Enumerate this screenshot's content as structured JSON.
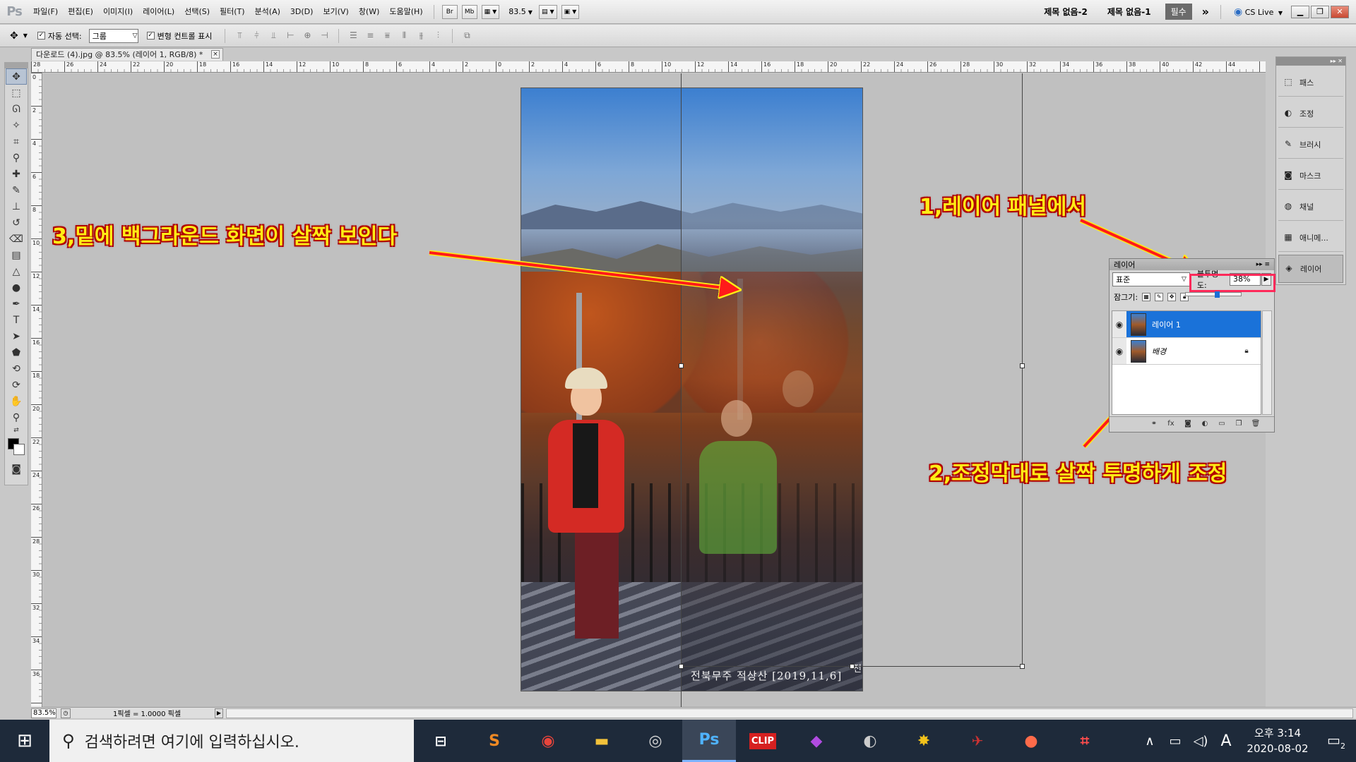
{
  "app": {
    "logo": "Ps",
    "menu": [
      "파일(F)",
      "편집(E)",
      "이미지(I)",
      "레이어(L)",
      "선택(S)",
      "필터(T)",
      "분석(A)",
      "3D(D)",
      "보기(V)",
      "창(W)",
      "도움말(H)"
    ],
    "bridge_btn": "Br",
    "minibridge_btn": "Mb",
    "zoom": "83.5",
    "workspaces": [
      "제목 없음-2",
      "제목 없음-1"
    ],
    "workspace_active": "필수",
    "more": "»",
    "cslive": "CS Live"
  },
  "options": {
    "auto_select_label": "자동 선택:",
    "auto_select_value": "그룹",
    "transform_controls_label": "변형 컨트롤 표시"
  },
  "document": {
    "tab_title": "다운로드 (4).jpg @ 83.5% (레이어 1, RGB/8) *",
    "close": "×",
    "watermark": "전북무주 적상산 [2019,11,6]",
    "watermark_tail": "전"
  },
  "rulers": {
    "top": [
      "28",
      "26",
      "24",
      "22",
      "20",
      "18",
      "16",
      "14",
      "12",
      "10",
      "8",
      "6",
      "4",
      "2",
      "0",
      "2",
      "4",
      "6",
      "8",
      "10",
      "12",
      "14",
      "16",
      "18",
      "20",
      "22",
      "24",
      "26",
      "28",
      "30",
      "32",
      "34",
      "36",
      "38",
      "40",
      "42",
      "44"
    ],
    "left": [
      "0",
      "2",
      "4",
      "6",
      "8",
      "10",
      "12",
      "14",
      "16",
      "18",
      "20",
      "22",
      "24",
      "26",
      "28",
      "30",
      "32",
      "34",
      "36"
    ]
  },
  "annotations": {
    "a1": "1,레이어 패널에서",
    "a2": "2,조정막대로 살짝 투명하게 조정",
    "a3": "3,밑에 백그라운드 화면이 살짝 보인다"
  },
  "panel_strip": [
    {
      "label": "패스",
      "icon": "paths-icon",
      "glyph": "⬚"
    },
    {
      "label": "조정",
      "icon": "adjust-icon",
      "glyph": "◐"
    },
    {
      "label": "브러시",
      "icon": "brush-icon",
      "glyph": "✎"
    },
    {
      "label": "마스크",
      "icon": "mask-icon",
      "glyph": "◙"
    },
    {
      "label": "채널",
      "icon": "channels-icon",
      "glyph": "◍"
    },
    {
      "label": "애니메...",
      "icon": "animation-icon",
      "glyph": "▦"
    },
    {
      "label": "레이어",
      "icon": "layers-icon",
      "glyph": "◈"
    }
  ],
  "layers_panel": {
    "title": "레이어",
    "blend_mode": "표준",
    "opacity_label": "불투명도:",
    "opacity": "38%",
    "opacity_level": 0.38,
    "lock_label": "잠그기:",
    "layers": [
      {
        "name": "레이어 1",
        "active": true,
        "locked": false
      },
      {
        "name": "배경",
        "active": false,
        "locked": true
      }
    ]
  },
  "status": {
    "zoom": "83.5%",
    "info": "1픽셀 = 1.0000 픽셀"
  },
  "taskbar": {
    "search_placeholder": "검색하려면 여기에 입력하십시오.",
    "clock_time": "오후 3:14",
    "clock_date": "2020-08-02",
    "ime": "A",
    "notifications": "2"
  },
  "colors": {
    "annotation_text": "#ffec14",
    "annotation_outline": "#b00000",
    "arrow": "#ff1a1a",
    "highlight": "#ff2a5a",
    "selection": "#1a72d9"
  }
}
